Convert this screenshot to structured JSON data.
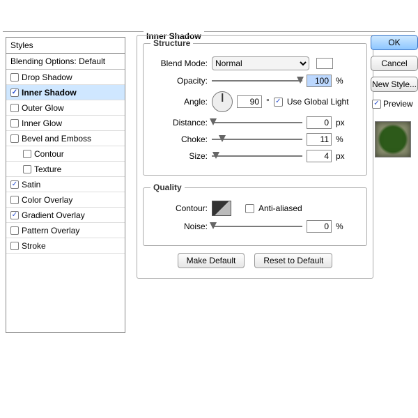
{
  "sidebar": {
    "header": "Styles",
    "sub": "Blending Options: Default",
    "items": [
      {
        "label": "Drop Shadow",
        "checked": false,
        "indent": 0,
        "selected": false
      },
      {
        "label": "Inner Shadow",
        "checked": true,
        "indent": 0,
        "selected": true
      },
      {
        "label": "Outer Glow",
        "checked": false,
        "indent": 0,
        "selected": false
      },
      {
        "label": "Inner Glow",
        "checked": false,
        "indent": 0,
        "selected": false
      },
      {
        "label": "Bevel and Emboss",
        "checked": false,
        "indent": 0,
        "selected": false
      },
      {
        "label": "Contour",
        "checked": false,
        "indent": 1,
        "selected": false
      },
      {
        "label": "Texture",
        "checked": false,
        "indent": 1,
        "selected": false
      },
      {
        "label": "Satin",
        "checked": true,
        "indent": 0,
        "selected": false
      },
      {
        "label": "Color Overlay",
        "checked": false,
        "indent": 0,
        "selected": false
      },
      {
        "label": "Gradient Overlay",
        "checked": true,
        "indent": 0,
        "selected": false
      },
      {
        "label": "Pattern Overlay",
        "checked": false,
        "indent": 0,
        "selected": false
      },
      {
        "label": "Stroke",
        "checked": false,
        "indent": 0,
        "selected": false
      }
    ]
  },
  "panel_title": "Inner Shadow",
  "structure": {
    "legend": "Structure",
    "blend_label": "Blend Mode:",
    "blend_value": "Normal",
    "opacity_label": "Opacity:",
    "opacity_value": "100",
    "opacity_unit": "%",
    "angle_label": "Angle:",
    "angle_value": "90",
    "angle_unit": "°",
    "global_label": "Use Global Light",
    "global_checked": true,
    "distance_label": "Distance:",
    "distance_value": "0",
    "distance_unit": "px",
    "choke_label": "Choke:",
    "choke_value": "11",
    "choke_unit": "%",
    "size_label": "Size:",
    "size_value": "4",
    "size_unit": "px"
  },
  "quality": {
    "legend": "Quality",
    "contour_label": "Contour:",
    "aa_label": "Anti-aliased",
    "aa_checked": false,
    "noise_label": "Noise:",
    "noise_value": "0",
    "noise_unit": "%"
  },
  "buttons": {
    "make_default": "Make Default",
    "reset_default": "Reset to Default"
  },
  "right": {
    "ok": "OK",
    "cancel": "Cancel",
    "new_style": "New Style...",
    "preview": "Preview",
    "preview_checked": true
  }
}
